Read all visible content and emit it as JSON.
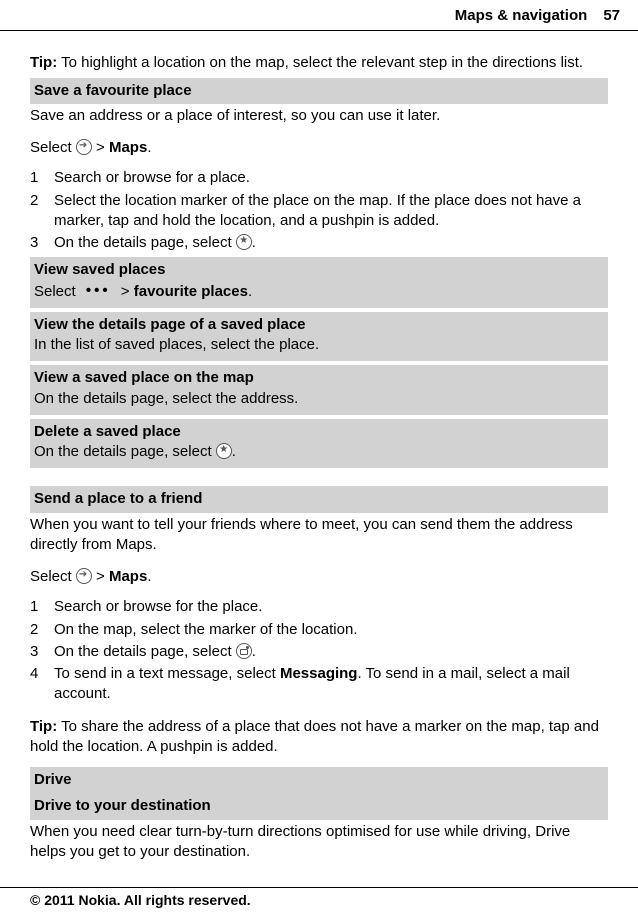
{
  "header": {
    "title": "Maps & navigation",
    "page": "57"
  },
  "tip_label": "Tip:",
  "tip1_text": " To highlight a location on the map, select the relevant step in the directions list.",
  "sec_save_fav": "Save a favourite place",
  "save_fav_intro": "Save an address or a place of interest, so you can use it later.",
  "select_prefix": "Select ",
  "gt": " > ",
  "maps_label": "Maps",
  "period": ".",
  "list1": {
    "n1": "1",
    "t1": "Search or browse for a place.",
    "n2": "2",
    "t2": "Select the location marker of the place on the map. If the place does not have a marker, tap and hold the location, and a pushpin is added.",
    "n3": "3",
    "t3a": "On the details page, select "
  },
  "block_view_saved_title": "View saved places",
  "block_view_saved_body_pre": "Select  ",
  "block_view_saved_body_post": "favourite places",
  "block_details_title": "View the details page of a saved place",
  "block_details_body": "In the list of saved places, select the place.",
  "block_onmap_title": "View a saved place on the map",
  "block_onmap_body": "On the details page, select the address.",
  "block_delete_title": "Delete a saved place",
  "block_delete_body_pre": "On the details page, select ",
  "sec_send_friend": "Send a place to a friend",
  "send_friend_intro": "When you want to tell your friends where to meet, you can send them the address directly from Maps.",
  "list2": {
    "n1": "1",
    "t1": "Search or browse for the place.",
    "n2": "2",
    "t2": "On the map, select the marker of the location.",
    "n3": "3",
    "t3a": "On the details page, select ",
    "n4": "4",
    "t4a": "To send in a text message, select ",
    "t4_msg": "Messaging",
    "t4b": ". To send in a mail, select a mail account."
  },
  "tip2_text": " To share the address of a place that does not have a marker on the map, tap and hold the location. A pushpin is added.",
  "sec_drive": "Drive",
  "sec_drive_dest": "Drive to your destination",
  "drive_intro": "When you need clear turn-by-turn directions optimised for use while driving, Drive helps you get to your destination.",
  "footer": "© 2011 Nokia. All rights reserved."
}
